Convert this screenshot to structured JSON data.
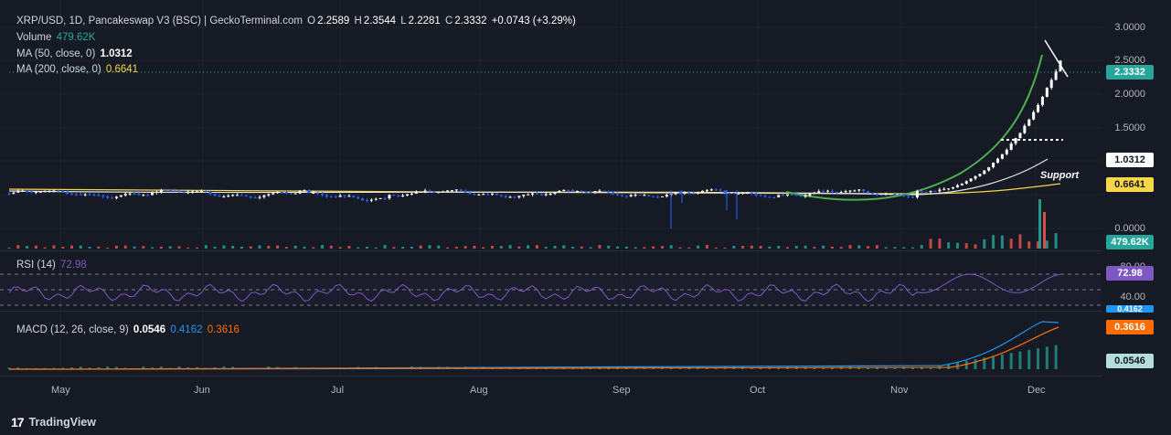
{
  "header": {
    "title": "XRP/USD, 1D, Pancakeswap V3 (BSC) | GeckoTerminal.com",
    "open_key": "O",
    "open": "2.2589",
    "high_key": "H",
    "high": "2.3544",
    "low_key": "L",
    "low": "2.2281",
    "close_key": "C",
    "close": "2.3332",
    "change": "+0.0743 (+3.29%)"
  },
  "legend": {
    "volume_label": "Volume",
    "volume_value": "479.62K",
    "ma50_label": "MA (50, close, 0)",
    "ma50_value": "1.0312",
    "ma200_label": "MA (200, close, 0)",
    "ma200_value": "0.6641"
  },
  "rsi": {
    "label": "RSI (14)",
    "value": "72.98",
    "level_top": "80.00",
    "level_bottom": "40.00"
  },
  "macd": {
    "label": "MACD (12, 26, close, 9)",
    "histogram": "0.0546",
    "macd_line": "0.4162",
    "signal": "0.3616"
  },
  "price_axis": [
    "3.0000",
    "2.5000",
    "2.0000",
    "1.5000",
    "0.0000"
  ],
  "price_tags": {
    "last": "2.3332",
    "ma50": "1.0312",
    "ma200": "0.6641",
    "volume": "479.62K",
    "rsi": "72.98",
    "macd_signal": "0.3616",
    "macd_hist": "0.0546",
    "macd_line": "0.4162"
  },
  "time_axis": [
    "May",
    "Jun",
    "Jul",
    "Aug",
    "Sep",
    "Oct",
    "Nov",
    "Dec"
  ],
  "annotation": {
    "support": "Support"
  },
  "footer": {
    "brand": "TradingView"
  },
  "colors": {
    "background": "#161a25",
    "up": "#26a69a",
    "down": "#ef5350",
    "candle_up": "#ffffff",
    "candle_down": "#2962ff",
    "ma50": "#e0e0e0",
    "ma200": "#f7d749",
    "rsi": "#7e57c2",
    "macd": "#2196f3",
    "signal": "#ff6d00",
    "curve": "#4caf50"
  },
  "chart_data": {
    "type": "candlestick",
    "symbol": "XRP/USD",
    "interval": "1D",
    "ylim": [
      0,
      3.0
    ],
    "months": [
      "May",
      "Jun",
      "Jul",
      "Aug",
      "Sep",
      "Oct",
      "Nov",
      "Dec"
    ],
    "price_approx": [
      {
        "month": "May",
        "close": 0.52
      },
      {
        "month": "Jun",
        "close": 0.48
      },
      {
        "month": "Jul",
        "close": 0.55
      },
      {
        "month": "Aug",
        "close": 0.58
      },
      {
        "month": "Sep",
        "close": 0.58
      },
      {
        "month": "Oct",
        "close": 0.52
      },
      {
        "month": "Nov",
        "close": 1.1
      },
      {
        "month": "Dec",
        "close": 2.33
      }
    ],
    "last": {
      "open": 2.2589,
      "high": 2.3544,
      "low": 2.2281,
      "close": 2.3332
    },
    "ma50_last": 1.0312,
    "ma200_last": 0.6641,
    "volume_last": 479620,
    "rsi_last": 72.98,
    "macd_last": {
      "macd": 0.4162,
      "signal": 0.3616,
      "histogram": 0.0546
    }
  }
}
